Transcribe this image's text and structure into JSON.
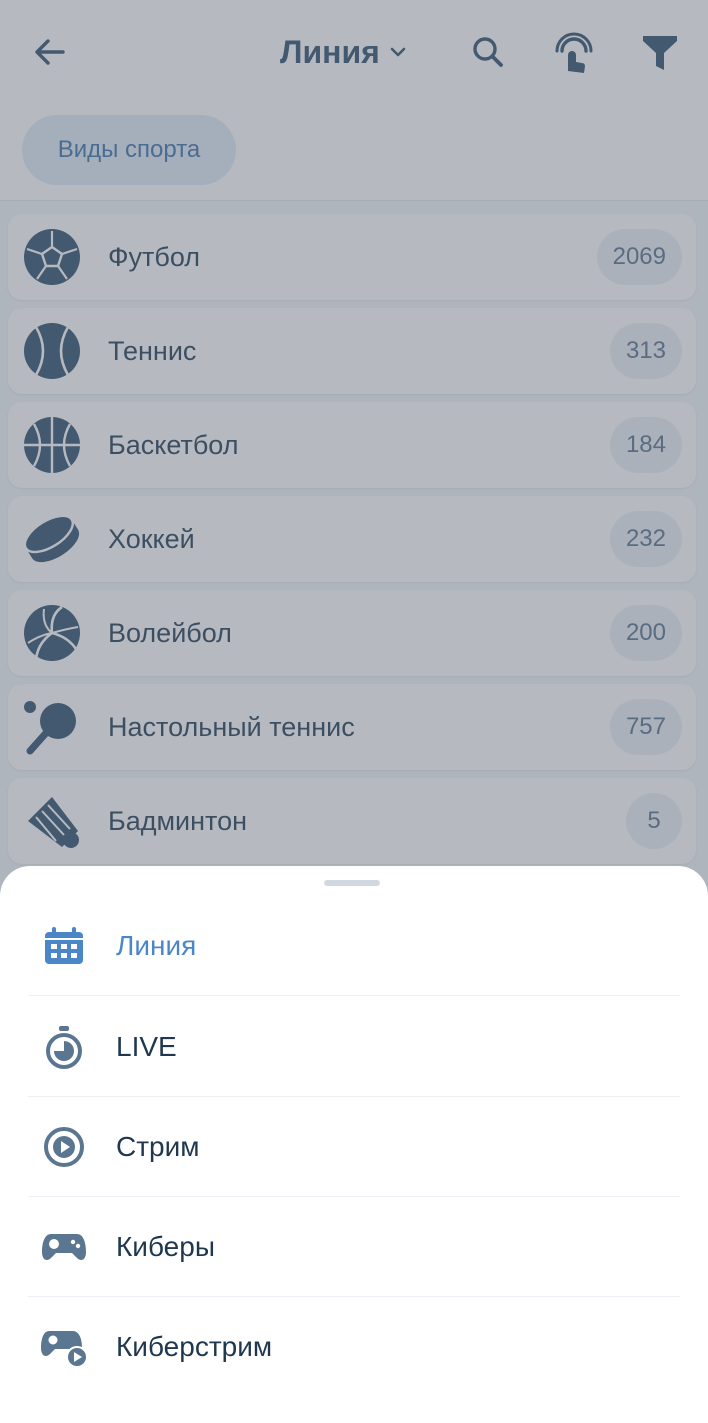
{
  "header": {
    "title": "Линия",
    "chip_label": "Виды спорта"
  },
  "sports": [
    {
      "name": "Футбол",
      "count": "2069",
      "icon": "soccer-ball-icon"
    },
    {
      "name": "Теннис",
      "count": "313",
      "icon": "tennis-ball-icon"
    },
    {
      "name": "Баскетбол",
      "count": "184",
      "icon": "basketball-icon"
    },
    {
      "name": "Хоккей",
      "count": "232",
      "icon": "hockey-puck-icon"
    },
    {
      "name": "Волейбол",
      "count": "200",
      "icon": "volleyball-icon"
    },
    {
      "name": "Настольный теннис",
      "count": "757",
      "icon": "table-tennis-icon"
    },
    {
      "name": "Бадминтон",
      "count": "5",
      "icon": "shuttlecock-icon"
    }
  ],
  "menu": [
    {
      "label": "Линия",
      "icon": "calendar-icon",
      "active": true
    },
    {
      "label": "LIVE",
      "icon": "stopwatch-icon",
      "active": false
    },
    {
      "label": "Стрим",
      "icon": "play-circle-icon",
      "active": false
    },
    {
      "label": "Киберы",
      "icon": "gamepad-icon",
      "active": false
    },
    {
      "label": "Киберстрим",
      "icon": "gamepad-stream-icon",
      "active": false
    }
  ],
  "colors": {
    "primary_text": "#1f3850",
    "accent": "#4a86c8",
    "icon": "#2c4d6c",
    "overlay": "rgba(95,105,118,0.46)"
  }
}
